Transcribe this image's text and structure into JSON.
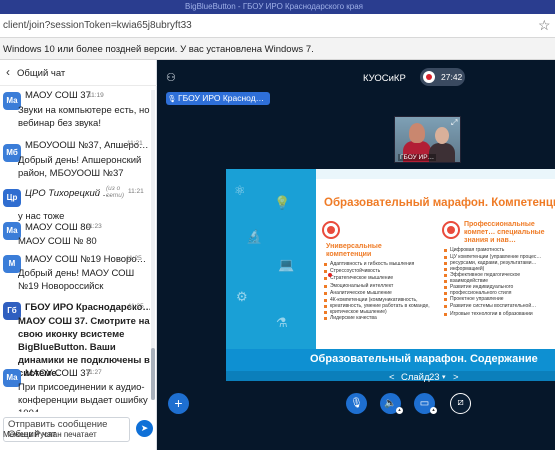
{
  "browser": {
    "tab_text": "BigBlueButton - ГБОУ ИРО Краснодарского края",
    "url": "client/join?sessionToken=kwia65j8ubryft33",
    "warning": "Windows 10 или более поздней версии. У вас установлена Windows 7."
  },
  "chat": {
    "title": "Общий чат",
    "messages": [
      {
        "avatar": "Ма",
        "avatar_color": "#3b7dd8",
        "sender": "МАОУ СОШ 37",
        "time": "11:19",
        "text": "Звуки на компьютере есть, но вебинар без звука!",
        "bold": false
      },
      {
        "avatar": "Мб",
        "avatar_color": "#3b7dd8",
        "sender": "МБОУООШ №37, Апшеро…",
        "time": "11:21",
        "text": "Добрый день! Апшеронский район, МБОУООШ №37",
        "bold": false
      },
      {
        "avatar": "Цр",
        "avatar_color": "#2f6dd0",
        "sender": "ЦРО Тихорецкий …",
        "time": "11:21",
        "edited": "(из о сети)",
        "text": "у нас тоже",
        "bold": false
      },
      {
        "avatar": "Ма",
        "avatar_color": "#3b7dd8",
        "sender": "МАОУ СОШ 80",
        "time": "11:23",
        "text": "МАОУ СОШ № 80",
        "bold": false
      },
      {
        "avatar": "М",
        "avatar_color": "#3b7dd8",
        "sender": "МАОУ СОШ №19 Новоро…",
        "time": "11:25",
        "text": "Добрый день! МАОУ СОШ №19 Новороссийск",
        "bold": false
      },
      {
        "avatar": "Гб",
        "avatar_color": "#2f5fc0",
        "sender": "ГБОУ ИРО Краснодарско…",
        "time": "11:25",
        "text": "МАОУ СОШ 37. Смотрите на свою иконку всистеме BigBlueButton. Ваши динамики не подключены в системе.",
        "bold": true
      },
      {
        "avatar": "Ма",
        "avatar_color": "#3b7dd8",
        "sender": "МАОУ СОШ 37",
        "time": "11:27",
        "text": "При присоединении к аудио-конференции выдает ошибку 1004",
        "bold": false
      }
    ],
    "input_placeholder": "Отправить сообщение Общий чат",
    "typing": "Межеев Руслан печатает"
  },
  "meeting": {
    "title": "КУОСиКР",
    "record_time": "27:42",
    "presenter": "ГБОУ ИРО Краснод…",
    "webcam_label": "ГБОУ ИР…"
  },
  "slide": {
    "title": "Образовательный марафон. Компетенции",
    "bottom_title": "Образовательный марафон. Содержание",
    "left_head": "Универсальные компетенции",
    "left_items": [
      "Адаптивность и гибкость мышления",
      "Стрессоустойчивость",
      "Стратегическое мышление",
      "Эмоциональный интеллект",
      "Аналитическое мышление",
      "4К-компетенции (коммуникативность,",
      "креативность, умение работать в команде,",
      "критическое мышление)",
      "Лидерские качества"
    ],
    "right_head": "Профессиональные компет… специальные знания и нав…",
    "right_items": [
      "Цифровая грамотность",
      "ЦУ компетенции (управление процес…",
      "ресурсами, кадрами, результатами…",
      "информацией)",
      "Эффективное педагогическое",
      "взаимодействие",
      "Развитие индивидуального",
      "профессионального стиля",
      "Проектное управление",
      "Развитие системы воспитательной…",
      "Игровые технологии в образовании"
    ]
  },
  "nav": {
    "prev": "<",
    "slide_label": "Слайд",
    "slide_number": "23",
    "next": ">"
  },
  "colors": {
    "accent": "#1e6fd0",
    "slide_blue": "#1aa0d6",
    "slide_orange": "#ef7b26",
    "meeting_bg": "#06172a"
  }
}
